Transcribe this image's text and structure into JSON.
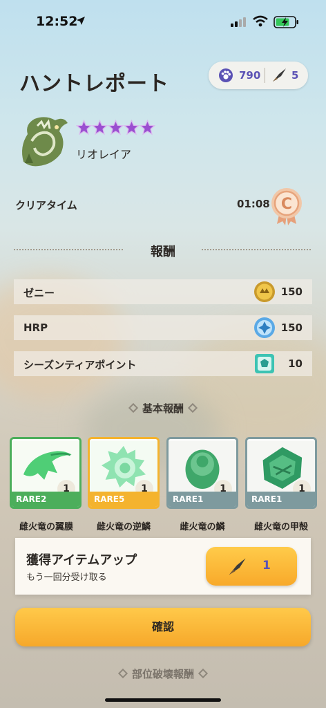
{
  "status_bar": {
    "time": "12:52"
  },
  "header": {
    "title": "ハントレポート"
  },
  "currency": {
    "gems": "790",
    "tickets": "5"
  },
  "monster": {
    "name": "リオレイア",
    "stars": 5
  },
  "clear": {
    "label": "クリアタイム",
    "time": "01:08",
    "rank": "C"
  },
  "rewards": {
    "title": "報酬",
    "rows": [
      {
        "label": "ゼニー",
        "value": "150",
        "icon": "zenny-coin-icon"
      },
      {
        "label": "HRP",
        "value": "150",
        "icon": "hrp-icon"
      },
      {
        "label": "シーズンティアポイント",
        "value": "10",
        "icon": "season-tier-icon"
      }
    ]
  },
  "basic_rewards": {
    "title": "基本報酬",
    "items": [
      {
        "name": "雌火竜の翼膜",
        "rarity": "RARE2",
        "qty": "1",
        "color": "#4cae5b"
      },
      {
        "name": "雌火竜の逆鱗",
        "rarity": "RARE5",
        "qty": "1",
        "color": "#f4b32e"
      },
      {
        "name": "雌火竜の鱗",
        "rarity": "RARE1",
        "qty": "1",
        "color": "#7e9a9e"
      },
      {
        "name": "雌火竜の甲殻",
        "rarity": "RARE1",
        "qty": "1",
        "color": "#7e9a9e"
      }
    ]
  },
  "bonus": {
    "title": "獲得アイテムアップ",
    "subtitle": "もう一回分受け取る",
    "count": "1"
  },
  "confirm": {
    "label": "確認"
  },
  "part_break": {
    "title": "部位破壊報酬"
  },
  "colors": {
    "accent": "#5b52b5",
    "button": "#f8a92a"
  }
}
